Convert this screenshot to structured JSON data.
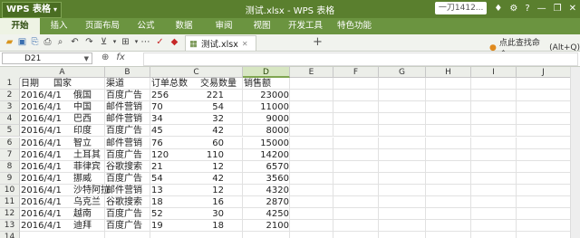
{
  "app": {
    "logo": "WPS 表格",
    "title": "测试.xlsx - WPS 表格",
    "user": "一刀1412...",
    "accent": "#5a7f2e"
  },
  "menu": [
    "开始",
    "插入",
    "页面布局",
    "公式",
    "数据",
    "审阅",
    "视图",
    "开发工具",
    "特色功能"
  ],
  "toolbar": {
    "doc_tab": "测试.xlsx",
    "find_label": "点此查找命令",
    "find_shortcut": "(Alt+Q)"
  },
  "formula_bar": {
    "cell_ref": "D21",
    "fx": "fx",
    "value": ""
  },
  "sheet": {
    "columns": [
      "A",
      "B",
      "C",
      "D",
      "E",
      "F",
      "G",
      "H",
      "I",
      "J"
    ],
    "selected_column": "D",
    "row_numbers": [
      "1",
      "2",
      "3",
      "4",
      "5",
      "6",
      "7",
      "8",
      "9",
      "10",
      "11",
      "12",
      "13",
      "14"
    ],
    "headers": [
      "日期",
      "国家",
      "渠道",
      "订单总数",
      "交易数量",
      "销售额"
    ],
    "rows": [
      [
        "2016/4/1",
        "俄国",
        "百度广告",
        "256",
        "221",
        "23000"
      ],
      [
        "2016/4/1",
        "中国",
        "邮件营销",
        "70",
        "54",
        "11000"
      ],
      [
        "2016/4/1",
        "巴西",
        "邮件营销",
        "34",
        "32",
        "9000"
      ],
      [
        "2016/4/1",
        "印度",
        "百度广告",
        "45",
        "42",
        "8000"
      ],
      [
        "2016/4/1",
        "智立",
        "邮件营销",
        "76",
        "60",
        "15000"
      ],
      [
        "2016/4/1",
        "土耳其",
        "百度广告",
        "120",
        "110",
        "14200"
      ],
      [
        "2016/4/1",
        "菲律宾",
        "谷歌搜索",
        "21",
        "12",
        "6570"
      ],
      [
        "2016/4/1",
        "挪威",
        "百度广告",
        "54",
        "42",
        "3560"
      ],
      [
        "2016/4/1",
        "沙特阿拉",
        "邮件营销",
        "13",
        "12",
        "4320"
      ],
      [
        "2016/4/1",
        "乌克兰",
        "谷歌搜索",
        "18",
        "16",
        "2870"
      ],
      [
        "2016/4/1",
        "越南",
        "百度广告",
        "52",
        "30",
        "4250"
      ],
      [
        "2016/4/1",
        "迪拜",
        "百度广告",
        "19",
        "18",
        "2100"
      ]
    ]
  }
}
